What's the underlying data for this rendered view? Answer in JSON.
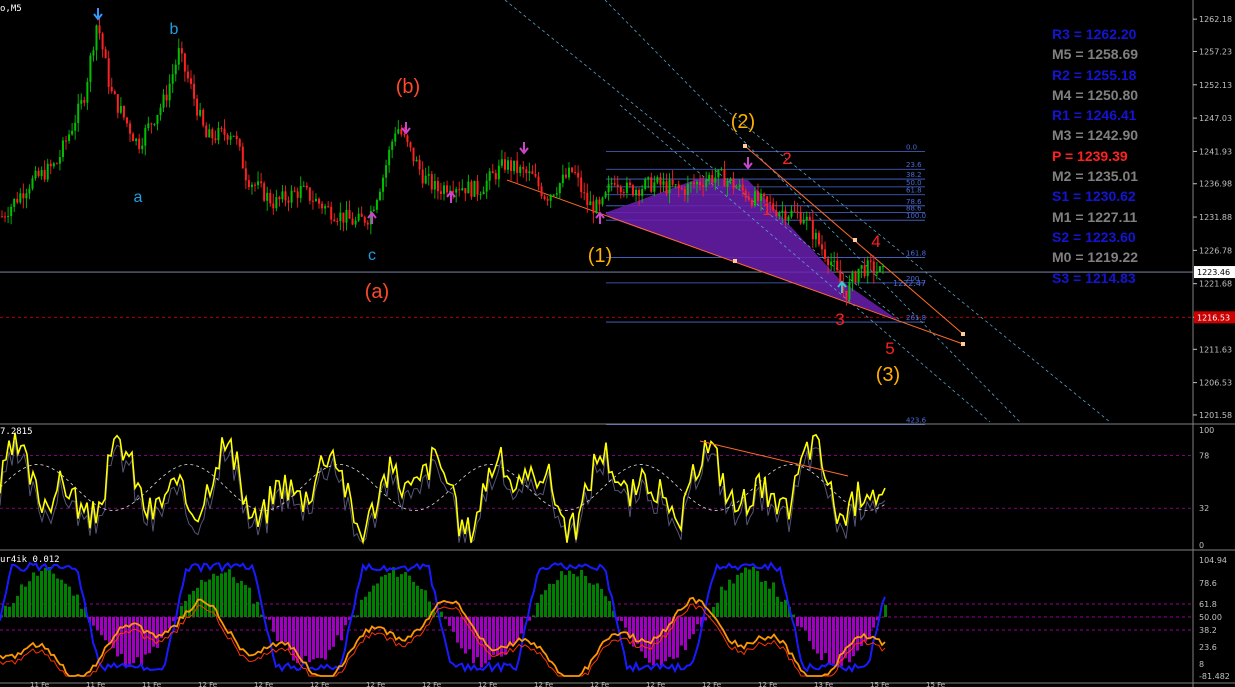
{
  "window": {
    "title": "o,M5"
  },
  "colors": {
    "background": "#000000",
    "bull_candle": "#00c000",
    "bear_candle": "#ff2020",
    "axis_text": "#c0c0c0",
    "pivot_resistance": "#1414d2",
    "pivot_mid": "#808080",
    "pivot_main": "#ff2020",
    "fib_lines": "#4b6bd6",
    "pattern_fill": "#6a1fb0",
    "osc_line": "#ffff00",
    "macd_blue": "#1a1aff",
    "macd_orange": "#ff9900",
    "hist_green": "#008000",
    "hist_purple": "#a000c0"
  },
  "price_axis": {
    "ticks": [
      "1262.18",
      "1257.23",
      "1252.13",
      "1247.03",
      "1241.93",
      "1236.98",
      "1231.88",
      "1226.78",
      "1221.68",
      "1216.53",
      "1211.63",
      "1206.53",
      "1201.58"
    ],
    "current_price": "1223.46",
    "alert_price": "1216.53"
  },
  "wave_labels": {
    "a": "a",
    "b": "b",
    "c": "c",
    "A": "(a)",
    "B": "(b)",
    "w1": "(1)",
    "w2": "(2)",
    "w3": "(3)",
    "s1": "1",
    "s2": "2",
    "s3": "3",
    "s4": "4",
    "s5": "5"
  },
  "fib_levels": [
    "0.0",
    "23.6",
    "38.2",
    "50.0",
    "61.8",
    "78.6",
    "88.6",
    "100.0",
    "161.8",
    "200",
    "261.8",
    "423.6"
  ],
  "fib_price_tag": "1222.47",
  "pivots": [
    {
      "label": "R3 = 1262.20",
      "type": "resistance"
    },
    {
      "label": "M5 = 1258.69",
      "type": "mid"
    },
    {
      "label": "R2 = 1255.18",
      "type": "resistance"
    },
    {
      "label": "M4 = 1250.80",
      "type": "mid"
    },
    {
      "label": "R1 = 1246.41",
      "type": "resistance"
    },
    {
      "label": "M3 = 1242.90",
      "type": "mid"
    },
    {
      "label": "P  = 1239.39",
      "type": "main"
    },
    {
      "label": "M2 = 1235.01",
      "type": "mid"
    },
    {
      "label": "S1 = 1230.62",
      "type": "resistance"
    },
    {
      "label": "M1 = 1227.11",
      "type": "mid"
    },
    {
      "label": "S2 = 1223.60",
      "type": "resistance"
    },
    {
      "label": "M0 = 1219.22",
      "type": "mid"
    },
    {
      "label": "S3 = 1214.83",
      "type": "resistance"
    }
  ],
  "oscillator": {
    "title": "7.2815",
    "ticks": [
      "100",
      "78",
      "32",
      "0"
    ]
  },
  "macd_pane": {
    "title": "ur4ik 0.012",
    "ticks": [
      "104.94",
      "78.6",
      "61.8",
      "50.00",
      "38.2",
      "23.6",
      "8",
      "-81.482"
    ]
  },
  "time_axis": {
    "labels": [
      "11 Fe",
      "11 Fe",
      "11 Fe",
      "12 Fe",
      "12 Fe",
      "12 Fe",
      "12 Fe",
      "12 Fe",
      "12 Fe",
      "12 Fe",
      "12 Fe",
      "12 Fe",
      "12 Fe",
      "12 Fe",
      "13 Fe",
      "15 Fe",
      "15 Fe"
    ]
  },
  "chart_data": {
    "type": "candlestick",
    "symbol_timeframe": "o,M5",
    "y_range": [
      1200.5,
      1264.5
    ],
    "approx_path": [
      [
        0,
        1232
      ],
      [
        4,
        1237
      ],
      [
        8,
        1240
      ],
      [
        12,
        1250
      ],
      [
        14,
        1262
      ],
      [
        16,
        1251
      ],
      [
        18,
        1247
      ],
      [
        20,
        1243
      ],
      [
        24,
        1250
      ],
      [
        26,
        1257
      ],
      [
        28,
        1251
      ],
      [
        30,
        1244
      ],
      [
        34,
        1245
      ],
      [
        36,
        1238
      ],
      [
        40,
        1234
      ],
      [
        44,
        1236
      ],
      [
        48,
        1233
      ],
      [
        52,
        1231
      ],
      [
        54,
        1232
      ],
      [
        56,
        1238
      ],
      [
        58,
        1246
      ],
      [
        60,
        1242
      ],
      [
        62,
        1238
      ],
      [
        64,
        1236
      ],
      [
        66,
        1237
      ],
      [
        70,
        1236
      ],
      [
        74,
        1240
      ],
      [
        78,
        1238
      ],
      [
        80,
        1235
      ],
      [
        84,
        1239
      ],
      [
        86,
        1234
      ],
      [
        88,
        1233
      ],
      [
        90,
        1238
      ],
      [
        92,
        1236
      ],
      [
        96,
        1237
      ],
      [
        100,
        1236
      ],
      [
        104,
        1238
      ],
      [
        106,
        1238
      ],
      [
        110,
        1235
      ],
      [
        114,
        1233
      ],
      [
        118,
        1232
      ],
      [
        120,
        1228
      ],
      [
        122,
        1225
      ],
      [
        124,
        1220
      ],
      [
        126,
        1224
      ],
      [
        128,
        1224
      ],
      [
        130,
        1223
      ]
    ]
  }
}
